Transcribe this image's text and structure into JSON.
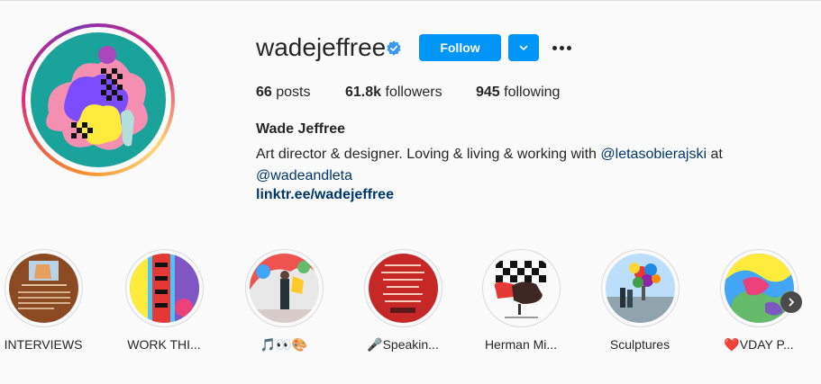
{
  "profile": {
    "username": "wadejeffree",
    "follow_label": "Follow",
    "stats": {
      "posts_count": "66",
      "posts_label": "posts",
      "followers_count": "61.8k",
      "followers_label": "followers",
      "following_count": "945",
      "following_label": "following"
    },
    "bio": {
      "full_name": "Wade Jeffree",
      "text_part1": "Art director & designer. Loving & living & working with ",
      "mention1": "@letasobierajski",
      "text_part2": " at ",
      "mention2": "@wadeandleta",
      "link": "linktr.ee/wadejeffree"
    }
  },
  "highlights": [
    {
      "label": "INTERVIEWS"
    },
    {
      "label": "WORK THI..."
    },
    {
      "label": "🎵👀🎨"
    },
    {
      "label": "🎤Speakin..."
    },
    {
      "label": "Herman Mi..."
    },
    {
      "label": "Sculptures"
    },
    {
      "label": "❤️VDAY P..."
    }
  ],
  "colors": {
    "accent": "#0095f6",
    "link": "#00376b",
    "verified": "#3897f0"
  },
  "icons": [
    "verified-badge-icon",
    "chevron-down-icon",
    "more-options-icon",
    "chevron-right-icon"
  ]
}
